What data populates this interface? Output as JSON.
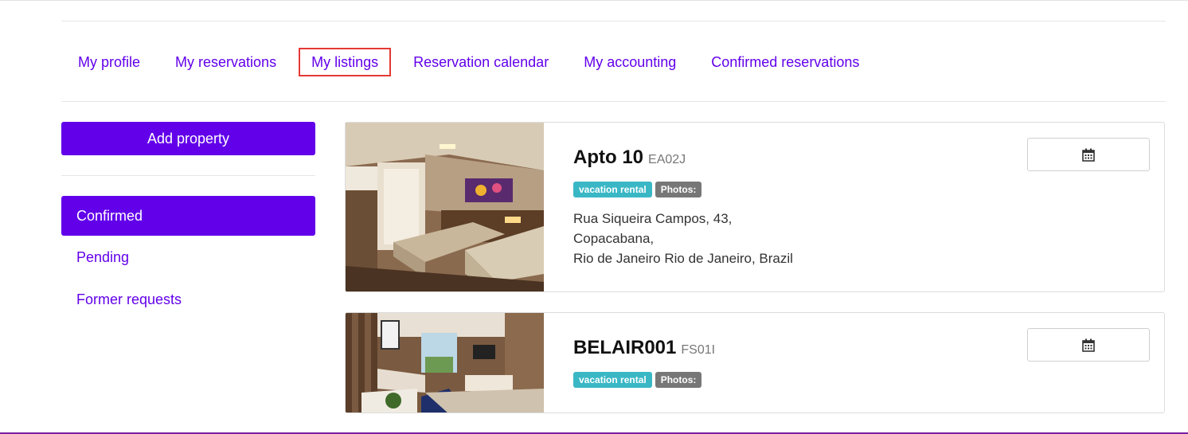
{
  "tabs": [
    {
      "label": "My profile",
      "active": false
    },
    {
      "label": "My reservations",
      "active": false
    },
    {
      "label": "My listings",
      "active": true
    },
    {
      "label": "Reservation calendar",
      "active": false
    },
    {
      "label": "My accounting",
      "active": false
    },
    {
      "label": "Confirmed reservations",
      "active": false
    }
  ],
  "sidebar": {
    "add_button": "Add property",
    "items": [
      {
        "label": "Confirmed",
        "active": true
      },
      {
        "label": "Pending",
        "active": false
      },
      {
        "label": "Former requests",
        "active": false
      }
    ]
  },
  "listings": [
    {
      "title": "Apto 10",
      "code": "EA02J",
      "badges": [
        "vacation rental",
        "Photos:"
      ],
      "address": [
        "Rua Siqueira Campos, 43,",
        "Copacabana,",
        "Rio de Janeiro Rio de Janeiro, Brazil"
      ],
      "image_icon": "bedroom-photo",
      "action_icon": "calendar-icon"
    },
    {
      "title": "BELAIR001",
      "code": "FS01I",
      "badges": [
        "vacation rental",
        "Photos:"
      ],
      "address": [],
      "image_icon": "living-room-photo",
      "action_icon": "calendar-icon"
    }
  ],
  "colors": {
    "accent": "#6200ea",
    "badge_teal": "#3ab7c5",
    "badge_gray": "#777777",
    "highlight_border": "#e53935"
  }
}
